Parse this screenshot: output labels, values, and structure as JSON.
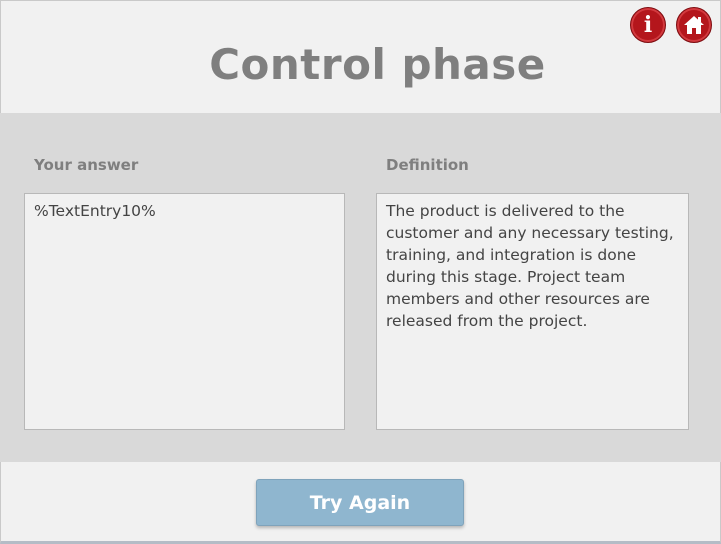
{
  "header": {
    "title": "Control phase",
    "info_icon": "info-icon",
    "home_icon": "home-icon",
    "icon_color": "#b4161c"
  },
  "answer": {
    "label": "Your answer",
    "value": "%TextEntry10%"
  },
  "definition": {
    "label": "Definition",
    "text": "The product is delivered to the customer and any necessary testing, training, and integration is done during this stage. Project team members and other resources are released from the project."
  },
  "actions": {
    "try_again_label": "Try Again",
    "button_color": "#8fb6cf"
  }
}
